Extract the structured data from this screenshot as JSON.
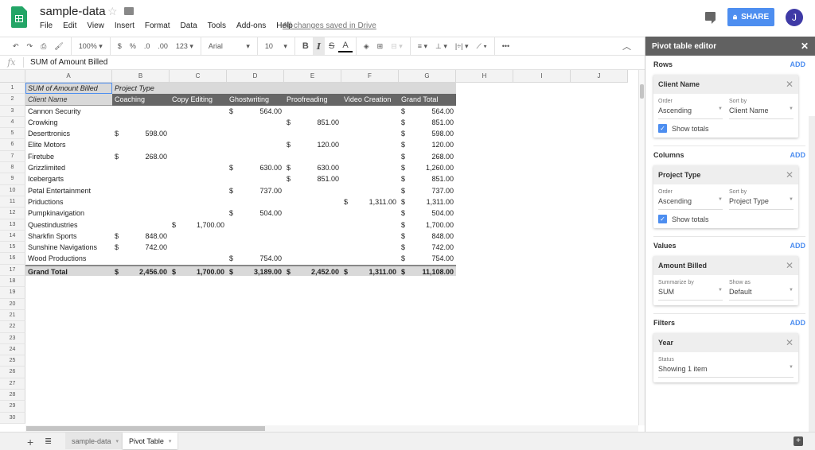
{
  "app": {
    "doc_title": "sample-data",
    "menus": [
      "File",
      "Edit",
      "View",
      "Insert",
      "Format",
      "Data",
      "Tools",
      "Add-ons",
      "Help"
    ],
    "save_status": "All changes saved in Drive",
    "share_label": "SHARE",
    "avatar_initial": "J",
    "brand_color": "#23a566",
    "accent_color": "#4d8ef0"
  },
  "toolbar": {
    "zoom": "100%",
    "currency": "$",
    "percent": "%",
    "dec_less": ".0",
    "dec_more": ".00",
    "number_format": "123",
    "font": "Arial",
    "font_size": "10",
    "bold": "B",
    "italic": "I",
    "strike": "S",
    "text_color": "A",
    "more": "•••"
  },
  "formula_bar": {
    "fx": "fx",
    "value": "SUM of  Amount Billed"
  },
  "grid": {
    "columns": [
      "A",
      "B",
      "C",
      "D",
      "E",
      "F",
      "G",
      "H",
      "I",
      "J"
    ],
    "row_numbers": [
      "1",
      "2",
      "3",
      "4",
      "5",
      "6",
      "7",
      "8",
      "9",
      "10",
      "11",
      "12",
      "13",
      "14",
      "15",
      "16",
      "17",
      "18",
      "19",
      "20",
      "21",
      "22",
      "23",
      "24",
      "25",
      "26",
      "27",
      "28",
      "29",
      "30"
    ],
    "pivot_header": {
      "a1": "SUM of  Amount Billed",
      "b1": "Project Type"
    },
    "col_headers": [
      "Client Name",
      "Coaching",
      "Copy Editing",
      "Ghostwriting",
      "Proofreading",
      "Video Creation",
      "Grand Total"
    ],
    "rows": [
      {
        "client": "Cannon Security",
        "values": [
          "",
          "",
          "564.00",
          "",
          "",
          "564.00"
        ]
      },
      {
        "client": "Crowking",
        "values": [
          "",
          "",
          "",
          "851.00",
          "",
          "851.00"
        ]
      },
      {
        "client": "Deserttronics",
        "values": [
          "598.00",
          "",
          "",
          "",
          "",
          "598.00"
        ]
      },
      {
        "client": "Elite Motors",
        "values": [
          "",
          "",
          "",
          "120.00",
          "",
          "120.00"
        ]
      },
      {
        "client": "Firetube",
        "values": [
          "268.00",
          "",
          "",
          "",
          "",
          "268.00"
        ]
      },
      {
        "client": "Grizzlimited",
        "values": [
          "",
          "",
          "630.00",
          "630.00",
          "",
          "1,260.00"
        ]
      },
      {
        "client": "Icebergarts",
        "values": [
          "",
          "",
          "",
          "851.00",
          "",
          "851.00"
        ]
      },
      {
        "client": "Petal Entertainment",
        "values": [
          "",
          "",
          "737.00",
          "",
          "",
          "737.00"
        ]
      },
      {
        "client": "Priductions",
        "values": [
          "",
          "",
          "",
          "",
          "1,311.00",
          "1,311.00"
        ]
      },
      {
        "client": "Pumpkinavigation",
        "values": [
          "",
          "",
          "504.00",
          "",
          "",
          "504.00"
        ]
      },
      {
        "client": "Questindustries",
        "values": [
          "",
          "1,700.00",
          "",
          "",
          "",
          "1,700.00"
        ]
      },
      {
        "client": "Sharkfin Sports",
        "values": [
          "848.00",
          "",
          "",
          "",
          "",
          "848.00"
        ]
      },
      {
        "client": "Sunshine Navigations",
        "values": [
          "742.00",
          "",
          "",
          "",
          "",
          "742.00"
        ]
      },
      {
        "client": "Wood Productions",
        "values": [
          "",
          "",
          "754.00",
          "",
          "",
          "754.00"
        ]
      }
    ],
    "grand_total": {
      "label": "Grand Total",
      "values": [
        "2,456.00",
        "1,700.00",
        "3,189.00",
        "2,452.00",
        "1,311.00",
        "11,108.00"
      ]
    },
    "currency_symbol": "$"
  },
  "sheets": {
    "tabs": [
      {
        "label": "sample-data",
        "active": false
      },
      {
        "label": "Pivot Table",
        "active": true
      }
    ]
  },
  "panel": {
    "title": "Pivot table editor",
    "add_label": "ADD",
    "rows": {
      "title": "Rows",
      "field": "Client Name",
      "order_label": "Order",
      "order_value": "Ascending",
      "sort_label": "Sort by",
      "sort_value": "Client Name",
      "show_totals": "Show totals"
    },
    "columns": {
      "title": "Columns",
      "field": "Project Type",
      "order_label": "Order",
      "order_value": "Ascending",
      "sort_label": "Sort by",
      "sort_value": "Project Type",
      "show_totals": "Show totals"
    },
    "values": {
      "title": "Values",
      "field": "Amount Billed",
      "summarize_label": "Summarize by",
      "summarize_value": "SUM",
      "show_as_label": "Show as",
      "show_as_value": "Default"
    },
    "filters": {
      "title": "Filters",
      "field": "Year",
      "status_label": "Status",
      "status_value": "Showing 1 item"
    }
  }
}
